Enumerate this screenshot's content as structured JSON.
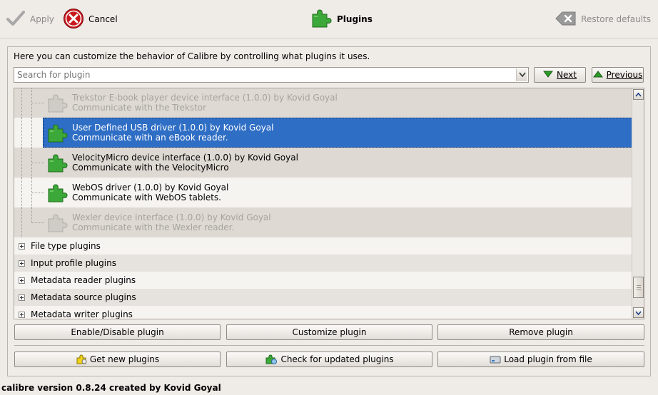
{
  "toolbar": {
    "apply_label": "Apply",
    "cancel_label": "Cancel",
    "title": "Plugins",
    "restore_label": "Restore defaults"
  },
  "panel": {
    "description": "Here you can customize the behavior of Calibre by controlling what plugins it uses.",
    "search_placeholder": "Search for plugin",
    "next_label": "Next",
    "previous_label": "Previous"
  },
  "plugins": [
    {
      "name": "Trekstor E-book player device interface (1.0.0) by Kovid Goyal",
      "desc": "Communicate with the Trekstor",
      "state": "disabled"
    },
    {
      "name": "User Defined USB driver (1.0.0) by Kovid Goyal",
      "desc": "Communicate with an eBook reader.",
      "state": "selected"
    },
    {
      "name": "VelocityMicro device interface (1.0.0) by Kovid Goyal",
      "desc": "Communicate with the VelocityMicro",
      "state": "enabled"
    },
    {
      "name": "WebOS driver (1.0.0) by Kovid Goyal",
      "desc": "Communicate with WebOS tablets.",
      "state": "enabled"
    },
    {
      "name": "Wexler device interface (1.0.0) by Kovid Goyal",
      "desc": "Communicate with the Wexler reader.",
      "state": "disabled"
    }
  ],
  "categories": [
    "File type plugins",
    "Input profile plugins",
    "Metadata reader plugins",
    "Metadata source plugins",
    "Metadata writer plugins"
  ],
  "actions": {
    "enable_disable": "Enable/Disable plugin",
    "customize": "Customize plugin",
    "remove": "Remove plugin",
    "get_new": "Get new plugins",
    "check_updates": "Check for updated plugins",
    "load_file": "Load plugin from file"
  },
  "status_bar": "calibre version 0.8.24 created by Kovid Goyal",
  "colors": {
    "selection": "#2f6ec5",
    "puzzle_green": "#3da83a",
    "cancel_red": "#c8171d"
  }
}
